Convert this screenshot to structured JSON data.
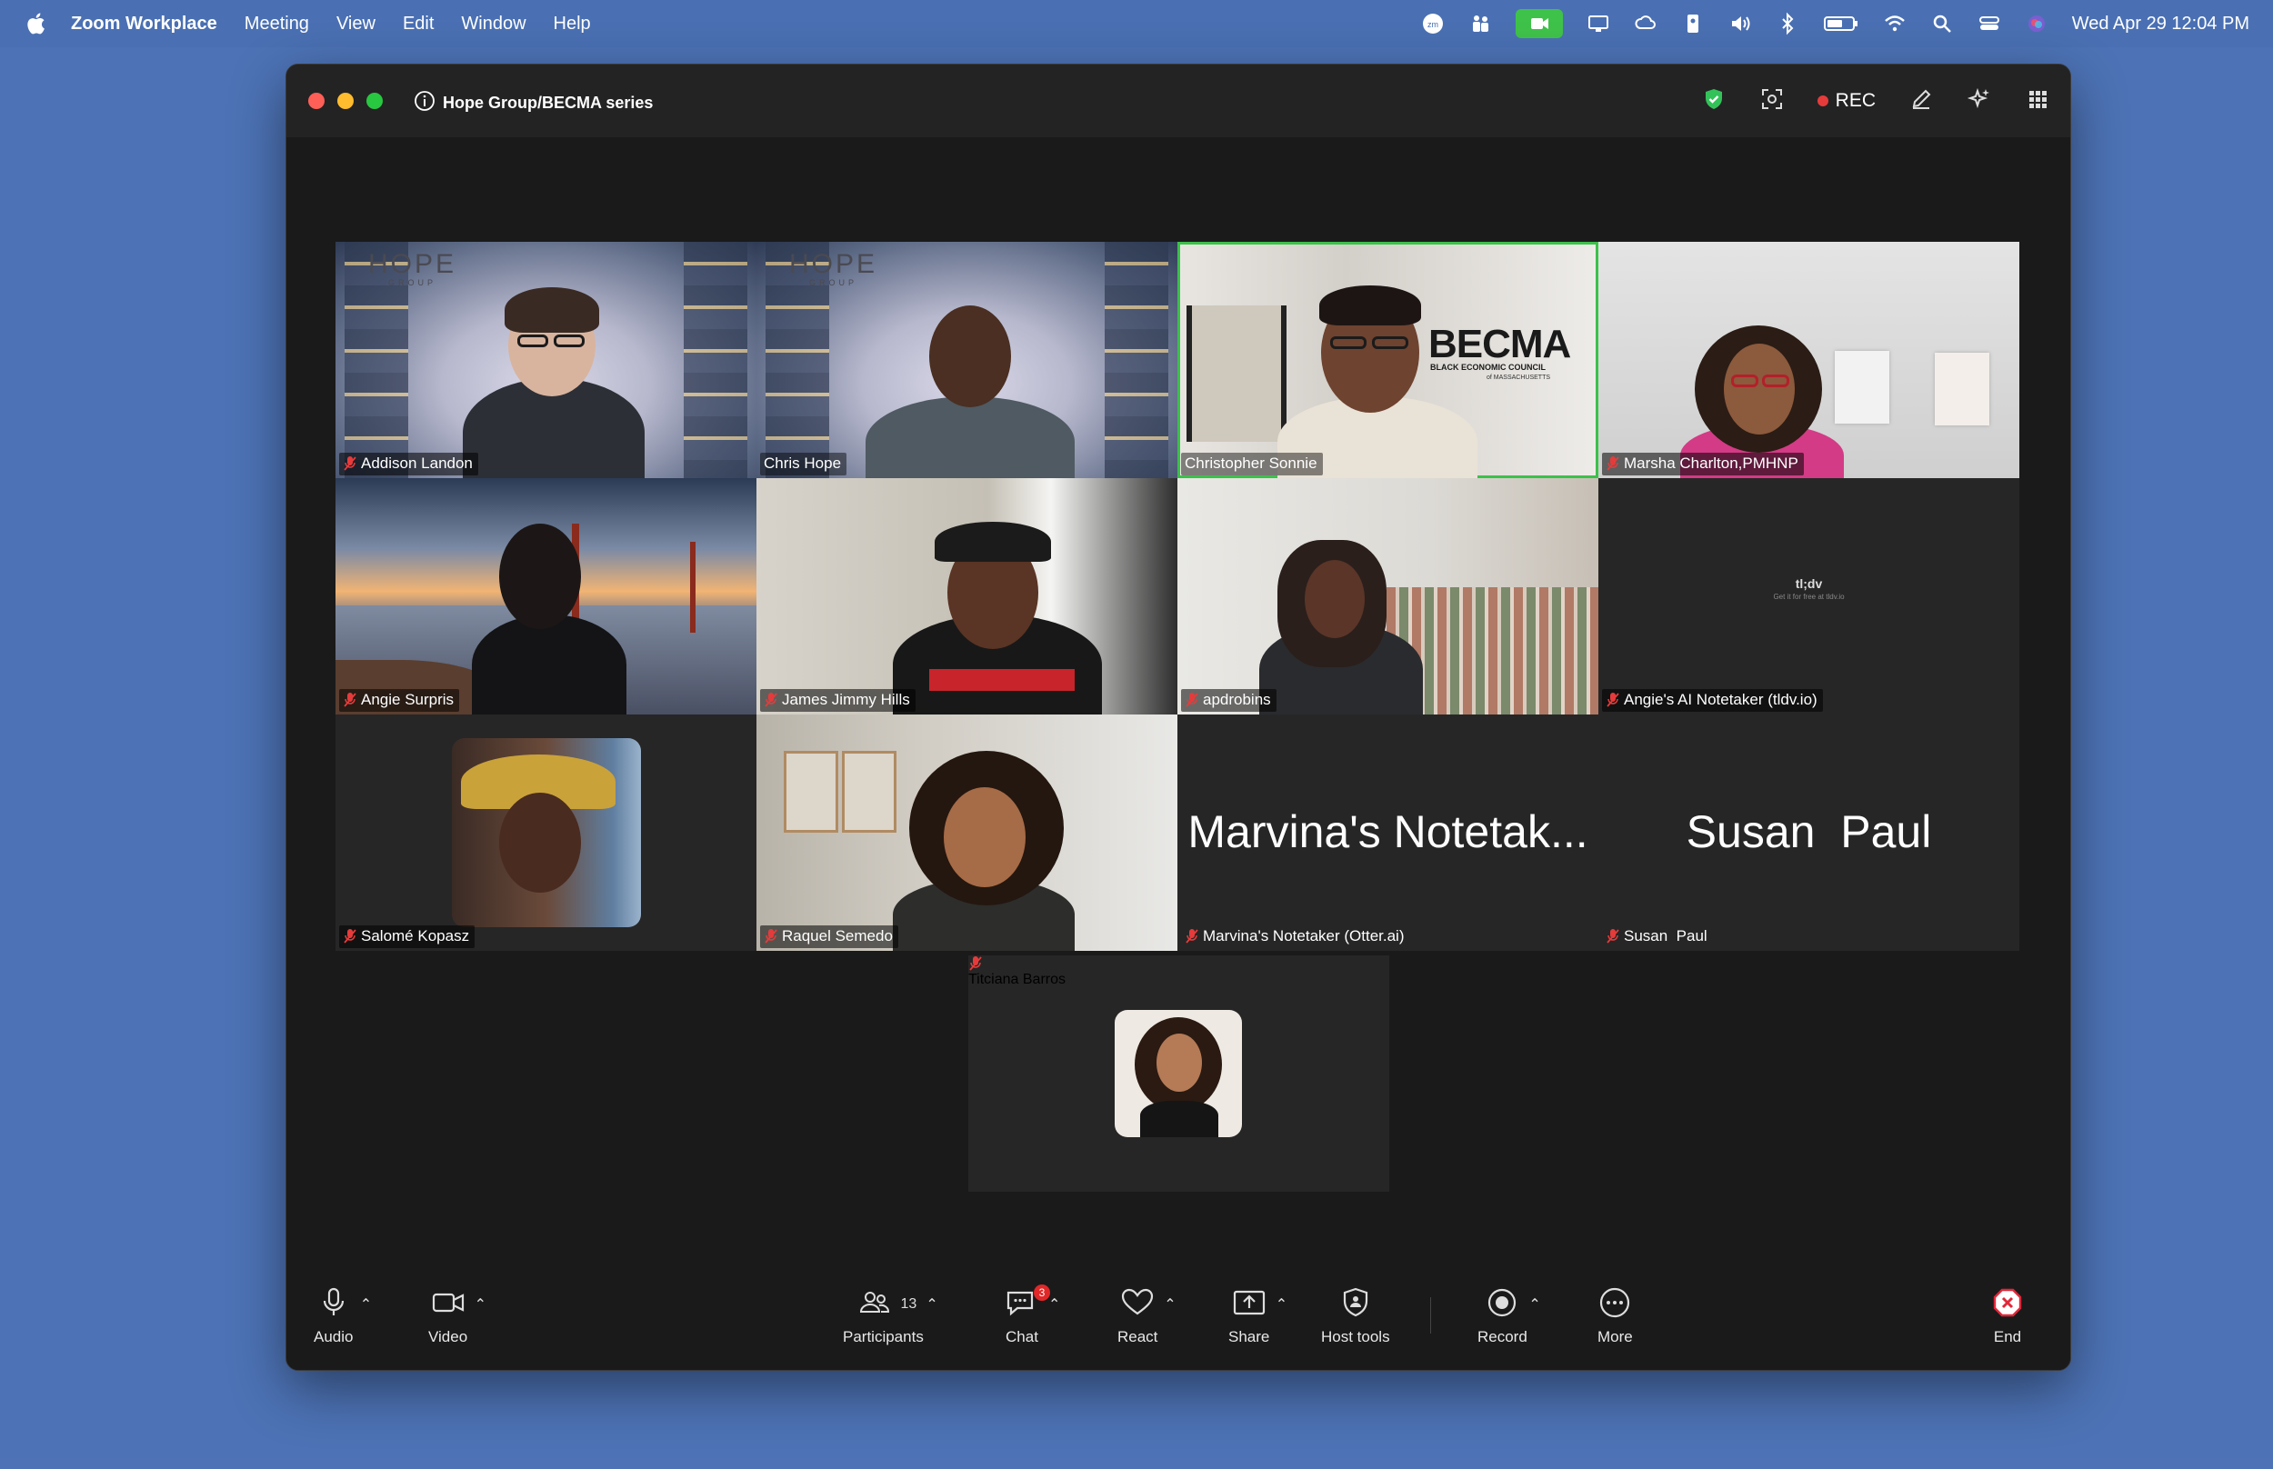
{
  "menubar": {
    "app_name": "Zoom Workplace",
    "menus": [
      "Meeting",
      "View",
      "Edit",
      "Window",
      "Help"
    ],
    "clock": "Wed Apr 29  12:04 PM"
  },
  "window": {
    "title": "Hope Group/BECMA series",
    "rec_label": "REC"
  },
  "participants": [
    {
      "name": "Addison Landon"
    },
    {
      "name": "Chris Hope"
    },
    {
      "name": "Christopher Sonnie"
    },
    {
      "name": "Marsha Charlton,PMHNP"
    },
    {
      "name": "Angie Surpris"
    },
    {
      "name": "James Jimmy Hills"
    },
    {
      "name": "apdrobins"
    },
    {
      "name": "Angie's AI Notetaker (tldv.io)"
    },
    {
      "name": "Salomé Kopasz"
    },
    {
      "name": "Raquel Semedo"
    },
    {
      "name": "Marvina's Notetaker (Otter.ai)",
      "display": "Marvina's Notetak..."
    },
    {
      "name": "Susan  Paul",
      "display": "Susan  Paul"
    },
    {
      "name": "Titciana Barros"
    }
  ],
  "backgrounds": {
    "hope_logo": "HOPE",
    "hope_sub": "GROUP",
    "becma": "BECMA",
    "becma_sub": "BLACK ECONOMIC COUNCIL",
    "becma_sub2": "of MASSACHUSETTS",
    "tldv_logo": "tl;dv",
    "tldv_sub": "Get it for free at tldv.io"
  },
  "toolbar": {
    "audio": "Audio",
    "video": "Video",
    "participants": "Participants",
    "participants_count": "13",
    "chat": "Chat",
    "chat_badge": "3",
    "react": "React",
    "share": "Share",
    "host_tools": "Host tools",
    "record": "Record",
    "more": "More",
    "end": "End"
  },
  "colors": {
    "desktop": "#4d73b6",
    "active_speaker": "#3bc14a",
    "end": "#e0283a"
  }
}
